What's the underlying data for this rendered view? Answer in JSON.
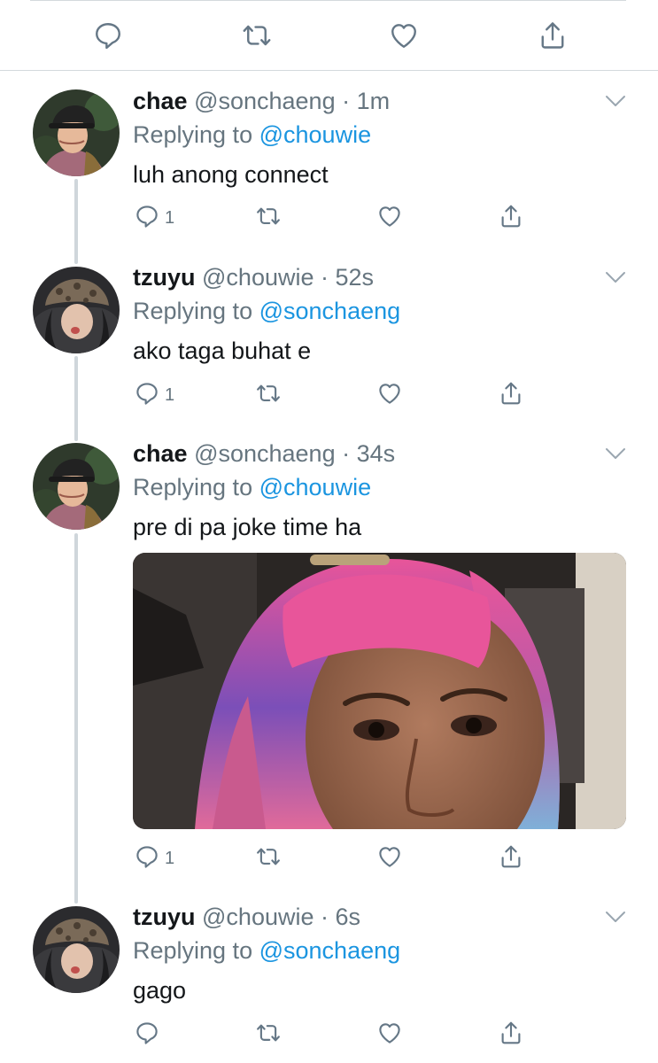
{
  "top_actions": {
    "icons": [
      "reply-icon",
      "retweet-icon",
      "like-icon",
      "share-icon"
    ]
  },
  "tweets": [
    {
      "name": "chae",
      "handle": "@sonchaeng",
      "time": "1m",
      "replying_prefix": "Replying to",
      "replying_to": "@chouwie",
      "text": "luh anong connect",
      "reply_count": "1"
    },
    {
      "name": "tzuyu",
      "handle": "@chouwie",
      "time": "52s",
      "replying_prefix": "Replying to",
      "replying_to": "@sonchaeng",
      "text": "ako taga buhat e",
      "reply_count": "1"
    },
    {
      "name": "chae",
      "handle": "@sonchaeng",
      "time": "34s",
      "replying_prefix": "Replying to",
      "replying_to": "@chouwie",
      "text": "pre di pa joke time ha",
      "reply_count": "1",
      "has_media": true
    },
    {
      "name": "tzuyu",
      "handle": "@chouwie",
      "time": "6s",
      "replying_prefix": "Replying to",
      "replying_to": "@sonchaeng",
      "text": "gago",
      "reply_count": ""
    }
  ],
  "colors": {
    "link": "#1b95e0",
    "secondary_text": "#66757f",
    "icon": "#657786",
    "thread_line": "#cfd6db"
  }
}
